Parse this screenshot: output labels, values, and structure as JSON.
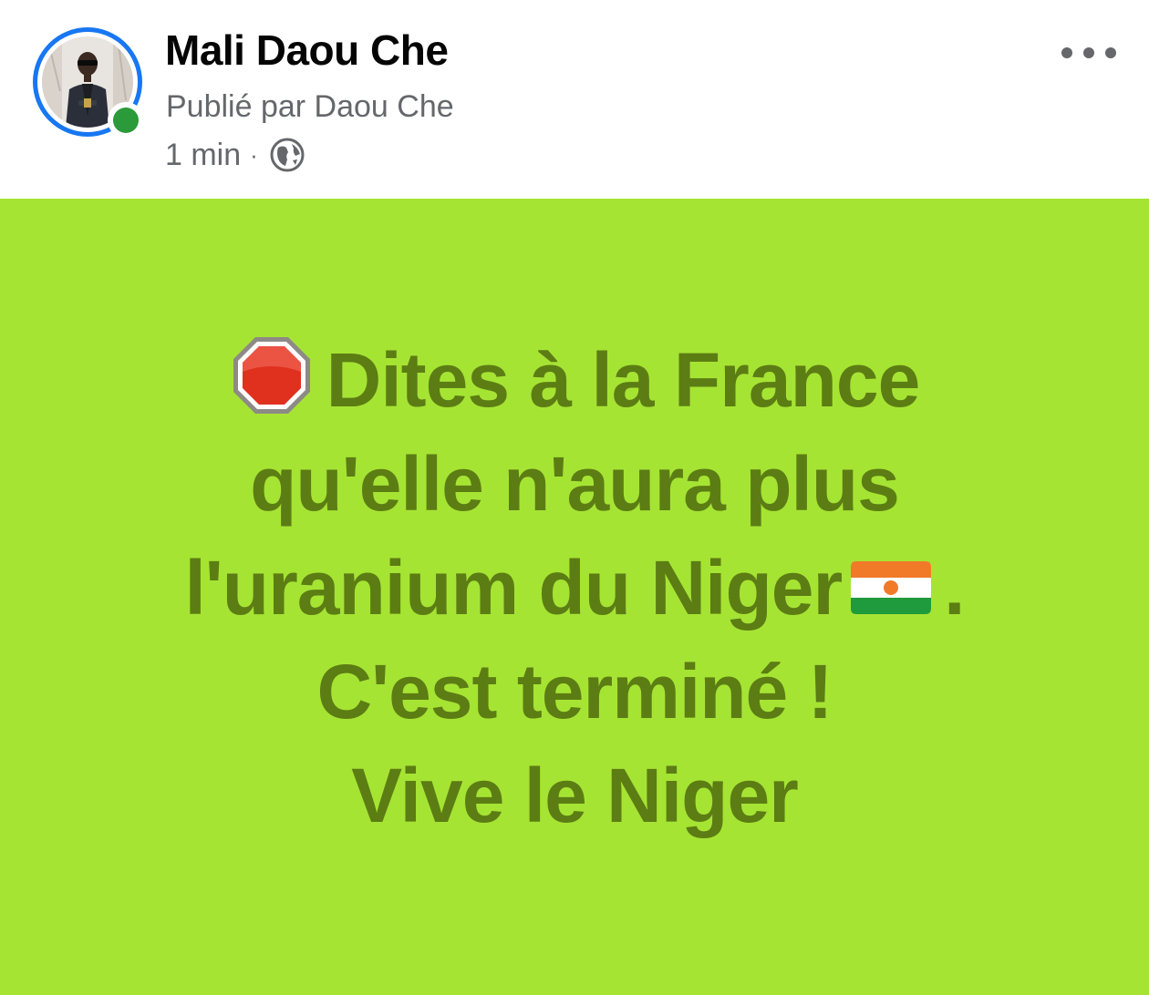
{
  "post": {
    "page_name": "Mali Daou Che",
    "published_by": "Publié par Daou Che",
    "time": "1 min",
    "separator": "·",
    "audience_icon": "globe-icon",
    "more_icon": "more-options-icon",
    "avatar_icon": "profile-photo",
    "online_status_color": "#2b9a3a"
  },
  "content": {
    "background_color": "#a6e434",
    "text_color": "#5c7d13",
    "emoji_stop": "stop-sign-icon",
    "emoji_flag": "niger-flag-icon",
    "line1": "Dites à la France",
    "line2": "qu'elle n'aura plus",
    "line3": "l'uranium du Niger",
    "line3_end": ".",
    "line4": "C'est terminé !",
    "line5": "Vive le Niger"
  }
}
